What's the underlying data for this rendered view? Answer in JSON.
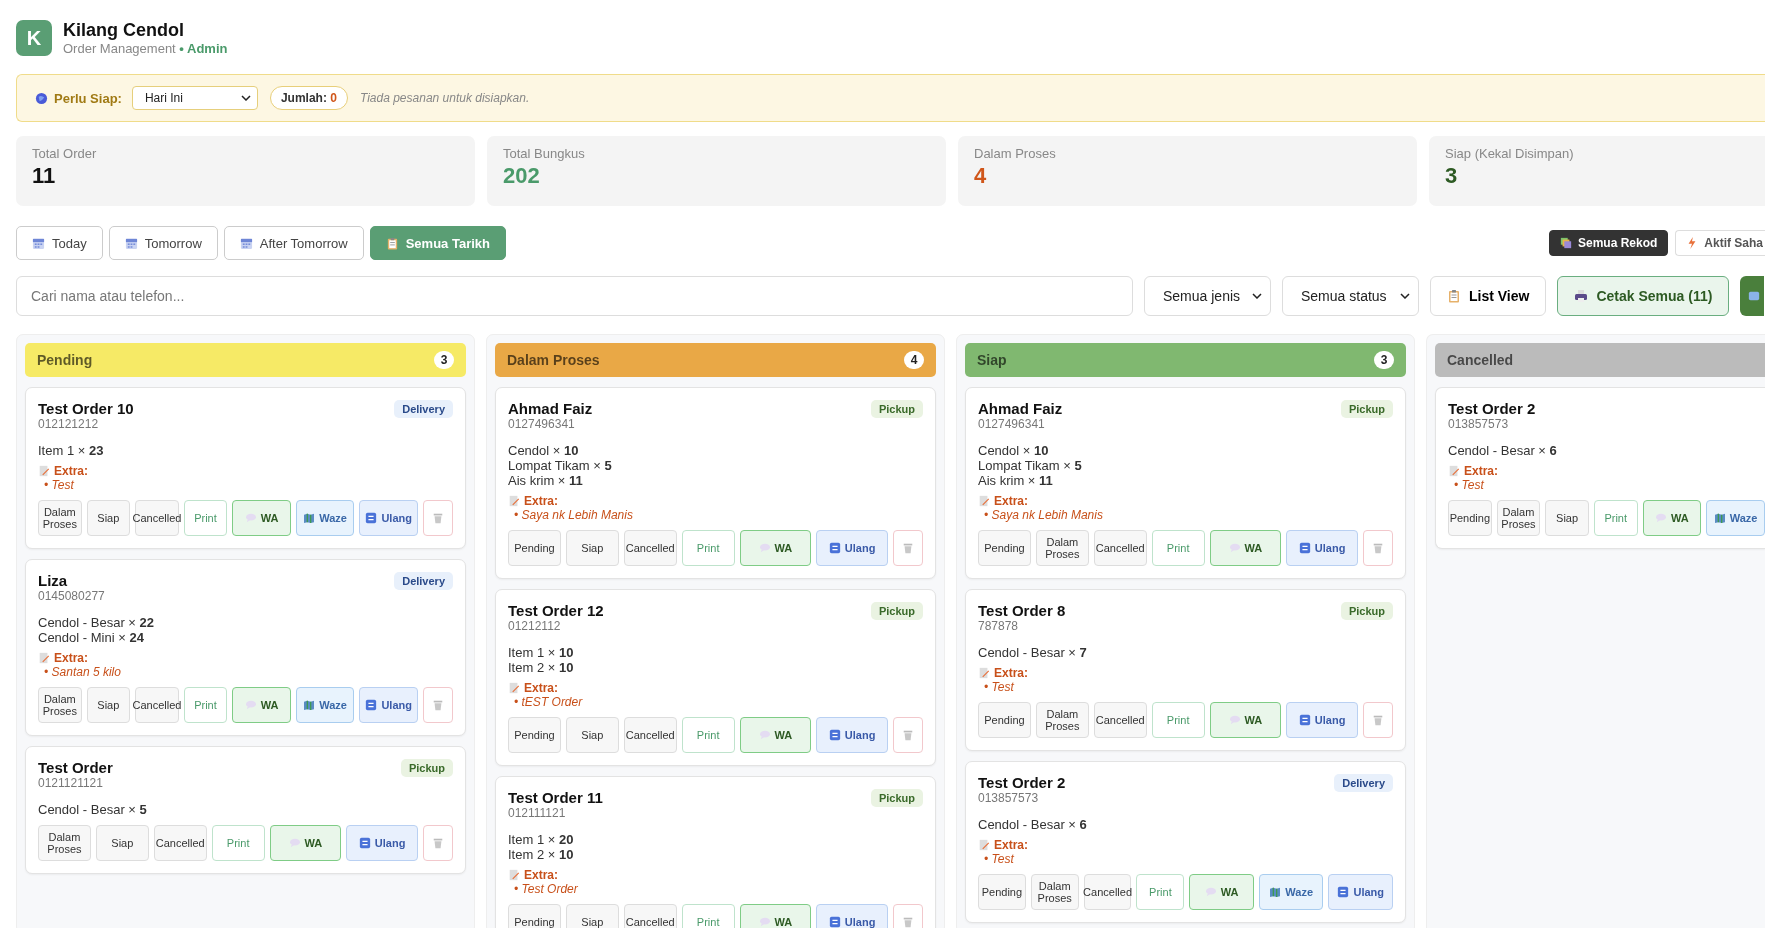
{
  "header": {
    "logo": "K",
    "title": "Kilang Cendol",
    "subtitle": "Order Management",
    "role": "• Admin"
  },
  "prep_bar": {
    "label": "Perlu Siap:",
    "select": "Hari Ini",
    "count_label": "Jumlah:",
    "count": "0",
    "message": "Tiada pesanan untuk disiapkan."
  },
  "stats": [
    {
      "label": "Total Order",
      "value": "11",
      "color": "#111111"
    },
    {
      "label": "Total Bungkus",
      "value": "202",
      "color": "#4a9a6a"
    },
    {
      "label": "Dalam Proses",
      "value": "4",
      "color": "#d0561a"
    },
    {
      "label": "Siap (Kekal Disimpan)",
      "value": "3",
      "color": "#2d5a23"
    }
  ],
  "date_filters": [
    {
      "label": "Today",
      "kind": "calendar",
      "selected": false
    },
    {
      "label": "Tomorrow",
      "kind": "calendar",
      "selected": false
    },
    {
      "label": "After Tomorrow",
      "kind": "calendar",
      "selected": false
    },
    {
      "label": "Semua Tarikh",
      "kind": "clipboard",
      "selected": true
    }
  ],
  "record_filters": [
    {
      "label": "Semua Rekod",
      "kind": "stack",
      "selected": true
    },
    {
      "label": "Aktif Saha",
      "kind": "bolt",
      "selected": false
    }
  ],
  "search": {
    "placeholder": "Cari nama atau telefon..."
  },
  "type_select": "Semua jenis",
  "status_select": "Semua status",
  "list_view": "List View",
  "print_all": "Cetak Semua (11)",
  "columns": [
    {
      "title": "Pending",
      "count": "3",
      "color": "#f6ea66",
      "orders": [
        {
          "name": "Test Order 10",
          "phone": "012121212",
          "type": "Delivery",
          "items": [
            "Item 1 × **23**"
          ],
          "extra": {
            "label": "Extra:",
            "notes": [
              "• Test"
            ]
          },
          "actions": [
            {
              "label": "Dalam Proses",
              "kind": "status"
            },
            {
              "label": "Siap",
              "kind": "status"
            },
            {
              "label": "Cancelled",
              "kind": "status"
            },
            {
              "label": "Print",
              "kind": "print"
            },
            {
              "label": "WA",
              "kind": "wa"
            },
            {
              "label": "Waze",
              "kind": "waze"
            },
            {
              "label": "Ulang",
              "kind": "ulang"
            },
            {
              "kind": "delete"
            }
          ]
        },
        {
          "name": "Liza",
          "phone": "0145080277",
          "type": "Delivery",
          "items": [
            "Cendol - Besar × **22**",
            "Cendol - Mini × **24**"
          ],
          "extra": {
            "label": "Extra:",
            "notes": [
              "• Santan 5 kilo"
            ]
          },
          "actions": [
            {
              "label": "Dalam Proses",
              "kind": "status"
            },
            {
              "label": "Siap",
              "kind": "status"
            },
            {
              "label": "Cancelled",
              "kind": "status"
            },
            {
              "label": "Print",
              "kind": "print"
            },
            {
              "label": "WA",
              "kind": "wa"
            },
            {
              "label": "Waze",
              "kind": "waze"
            },
            {
              "label": "Ulang",
              "kind": "ulang"
            },
            {
              "kind": "delete"
            }
          ]
        },
        {
          "name": "Test Order",
          "phone": "0121121121",
          "type": "Pickup",
          "items": [
            "Cendol - Besar × **5**"
          ],
          "actions": [
            {
              "label": "Dalam Proses",
              "kind": "status"
            },
            {
              "label": "Siap",
              "kind": "status"
            },
            {
              "label": "Cancelled",
              "kind": "status"
            },
            {
              "label": "Print",
              "kind": "print"
            },
            {
              "label": "WA",
              "kind": "wa"
            },
            {
              "label": "Ulang",
              "kind": "ulang"
            },
            {
              "kind": "delete"
            }
          ]
        }
      ]
    },
    {
      "title": "Dalam Proses",
      "count": "4",
      "color": "#e9a846",
      "orders": [
        {
          "name": "Ahmad Faiz",
          "phone": "0127496341",
          "type": "Pickup",
          "items": [
            "Cendol × **10**",
            "Lompat Tikam × **5**",
            "Ais krim × **11**"
          ],
          "extra": {
            "label": "Extra:",
            "notes": [
              "• Saya nk Lebih Manis"
            ]
          },
          "actions": [
            {
              "label": "Pending",
              "kind": "status"
            },
            {
              "label": "Siap",
              "kind": "status"
            },
            {
              "label": "Cancelled",
              "kind": "status"
            },
            {
              "label": "Print",
              "kind": "print"
            },
            {
              "label": "WA",
              "kind": "wa"
            },
            {
              "label": "Ulang",
              "kind": "ulang"
            },
            {
              "kind": "delete"
            }
          ]
        },
        {
          "name": "Test Order 12",
          "phone": "01212112",
          "type": "Pickup",
          "items": [
            "Item 1 × **10**",
            "Item 2 × **10**"
          ],
          "extra": {
            "label": "Extra:",
            "notes": [
              "• tEST Order"
            ]
          },
          "actions": [
            {
              "label": "Pending",
              "kind": "status"
            },
            {
              "label": "Siap",
              "kind": "status"
            },
            {
              "label": "Cancelled",
              "kind": "status"
            },
            {
              "label": "Print",
              "kind": "print"
            },
            {
              "label": "WA",
              "kind": "wa"
            },
            {
              "label": "Ulang",
              "kind": "ulang"
            },
            {
              "kind": "delete"
            }
          ]
        },
        {
          "name": "Test Order 11",
          "phone": "012111121",
          "type": "Pickup",
          "items": [
            "Item 1 × **20**",
            "Item 2 × **10**"
          ],
          "extra": {
            "label": "Extra:",
            "notes": [
              "• Test Order"
            ]
          },
          "actions": [
            {
              "label": "Pending",
              "kind": "status"
            },
            {
              "label": "Siap",
              "kind": "status"
            },
            {
              "label": "Cancelled",
              "kind": "status"
            },
            {
              "label": "Print",
              "kind": "print"
            },
            {
              "label": "WA",
              "kind": "wa"
            },
            {
              "label": "Ulang",
              "kind": "ulang"
            },
            {
              "kind": "delete"
            }
          ]
        }
      ]
    },
    {
      "title": "Siap",
      "count": "3",
      "color": "#80b870",
      "orders": [
        {
          "name": "Ahmad Faiz",
          "phone": "0127496341",
          "type": "Pickup",
          "items": [
            "Cendol × **10**",
            "Lompat Tikam × **5**",
            "Ais krim × **11**"
          ],
          "extra": {
            "label": "Extra:",
            "notes": [
              "• Saya nk Lebih Manis"
            ]
          },
          "actions": [
            {
              "label": "Pending",
              "kind": "status"
            },
            {
              "label": "Dalam Proses",
              "kind": "status"
            },
            {
              "label": "Cancelled",
              "kind": "status"
            },
            {
              "label": "Print",
              "kind": "print"
            },
            {
              "label": "WA",
              "kind": "wa"
            },
            {
              "label": "Ulang",
              "kind": "ulang"
            },
            {
              "kind": "delete"
            }
          ]
        },
        {
          "name": "Test Order 8",
          "phone": "787878",
          "type": "Pickup",
          "items": [
            "Cendol - Besar × **7**"
          ],
          "extra": {
            "label": "Extra:",
            "notes": [
              "• Test"
            ]
          },
          "actions": [
            {
              "label": "Pending",
              "kind": "status"
            },
            {
              "label": "Dalam Proses",
              "kind": "status"
            },
            {
              "label": "Cancelled",
              "kind": "status"
            },
            {
              "label": "Print",
              "kind": "print"
            },
            {
              "label": "WA",
              "kind": "wa"
            },
            {
              "label": "Ulang",
              "kind": "ulang"
            },
            {
              "kind": "delete"
            }
          ]
        },
        {
          "name": "Test Order 2",
          "phone": "013857573",
          "type": "Delivery",
          "items": [
            "Cendol - Besar × **6**"
          ],
          "extra": {
            "label": "Extra:",
            "notes": [
              "• Test"
            ]
          },
          "actions": [
            {
              "label": "Pending",
              "kind": "status"
            },
            {
              "label": "Dalam Proses",
              "kind": "status"
            },
            {
              "label": "Cancelled",
              "kind": "status"
            },
            {
              "label": "Print",
              "kind": "print"
            },
            {
              "label": "WA",
              "kind": "wa"
            },
            {
              "label": "Waze",
              "kind": "waze"
            },
            {
              "label": "Ulang",
              "kind": "ulang"
            }
          ]
        }
      ]
    },
    {
      "title": "Cancelled",
      "color": "#bbbbbb",
      "orders": [
        {
          "name": "Test Order 2",
          "phone": "013857573",
          "items": [
            "Cendol - Besar × **6**"
          ],
          "extra": {
            "label": "Extra:",
            "notes": [
              "• Test"
            ]
          },
          "actions": [
            {
              "label": "Pending",
              "kind": "status"
            },
            {
              "label": "Dalam Proses",
              "kind": "status"
            },
            {
              "label": "Siap",
              "kind": "status"
            },
            {
              "label": "Print",
              "kind": "print"
            },
            {
              "label": "WA",
              "kind": "wa"
            },
            {
              "label": "Waze",
              "kind": "waze"
            }
          ]
        }
      ]
    }
  ]
}
